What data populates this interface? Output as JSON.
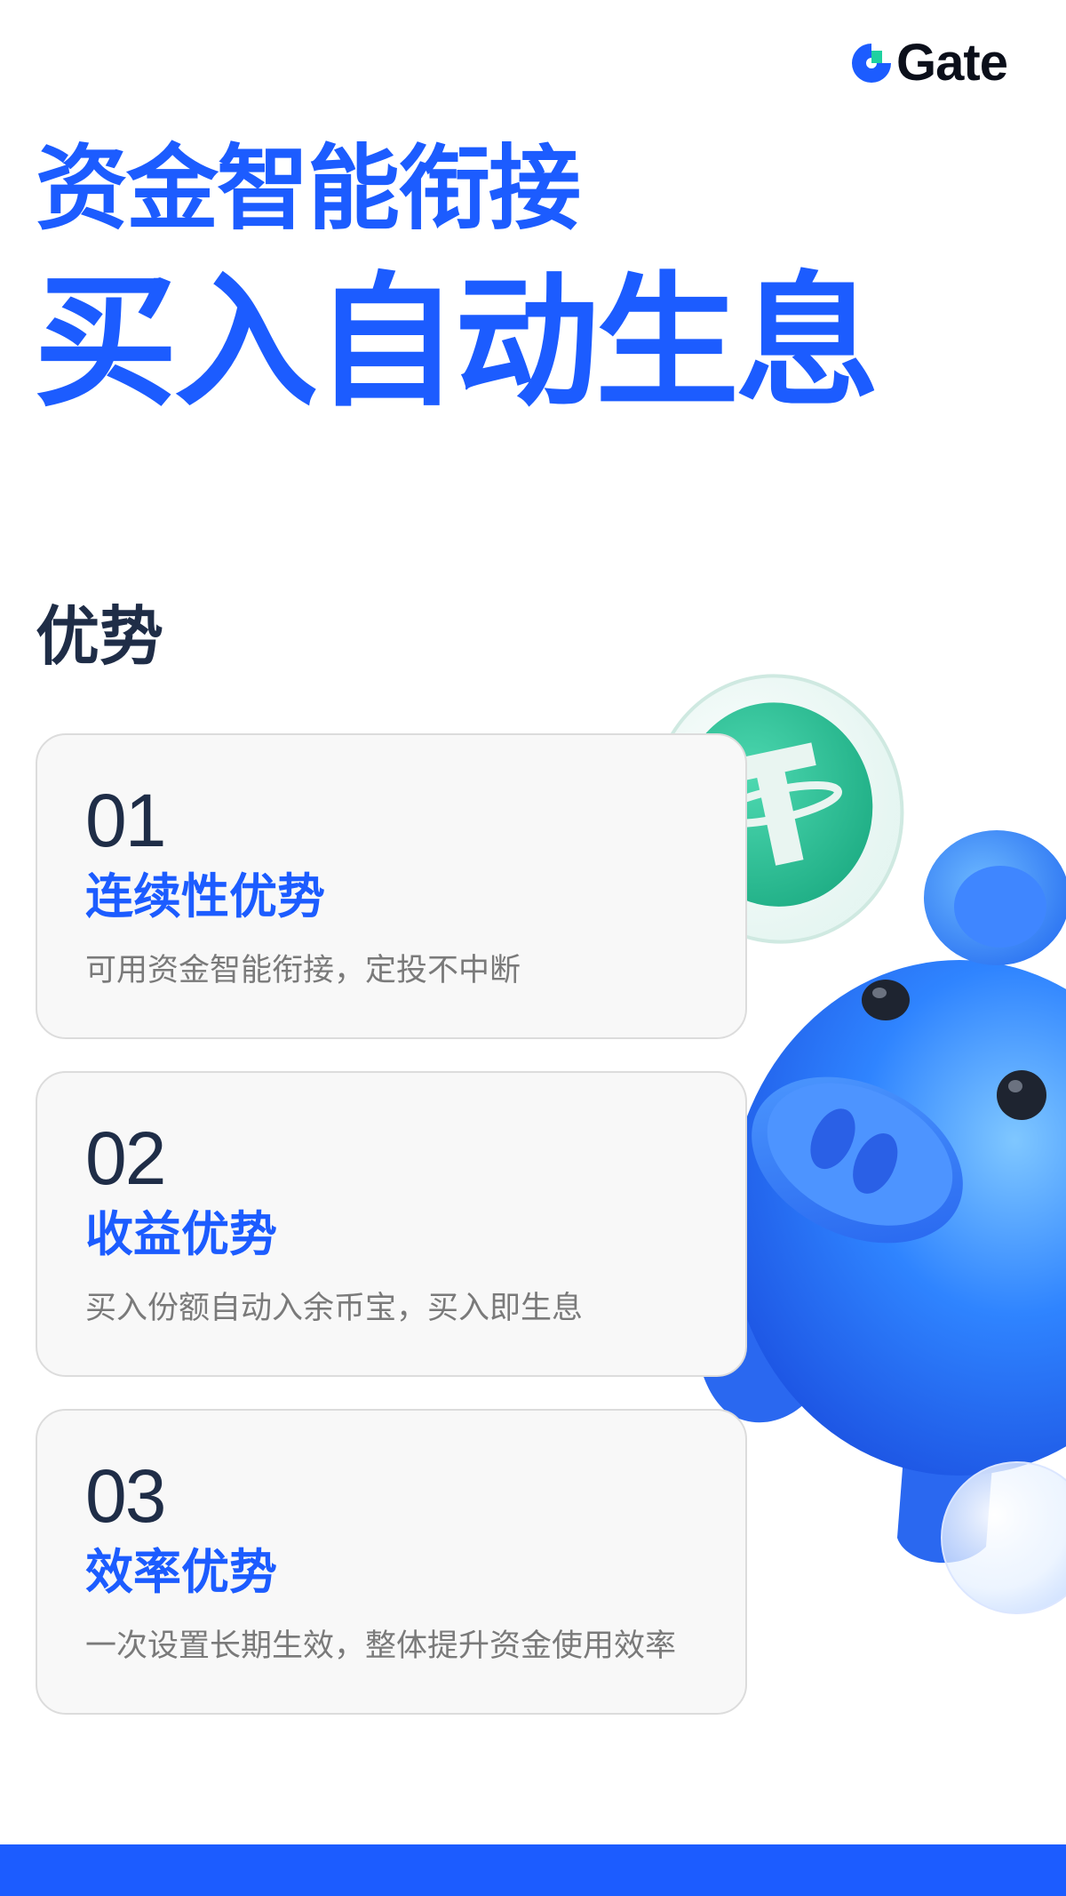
{
  "brand": {
    "name": "Gate",
    "icon": "gate-logo-icon",
    "color": "#1c5cff"
  },
  "hero": {
    "line1": "资金智能衔接",
    "line2": "买入自动生息"
  },
  "section": {
    "title": "优势"
  },
  "cards": [
    {
      "number": "01",
      "title": "连续性优势",
      "description": "可用资金智能衔接，定投不中断"
    },
    {
      "number": "02",
      "title": "收益优势",
      "description": "买入份额自动入余币宝，买入即生息"
    },
    {
      "number": "03",
      "title": "效率优势",
      "description": "一次设置长期生效，整体提升资金使用效率"
    }
  ],
  "illustration": {
    "coin_icon": "tether-coin-icon",
    "piggy_icon": "piggy-bank-icon"
  },
  "colors": {
    "accent": "#1c5cff",
    "dark_text": "#1f2d47",
    "muted_text": "#7a7a7a",
    "coin_green": "#2cc198"
  }
}
